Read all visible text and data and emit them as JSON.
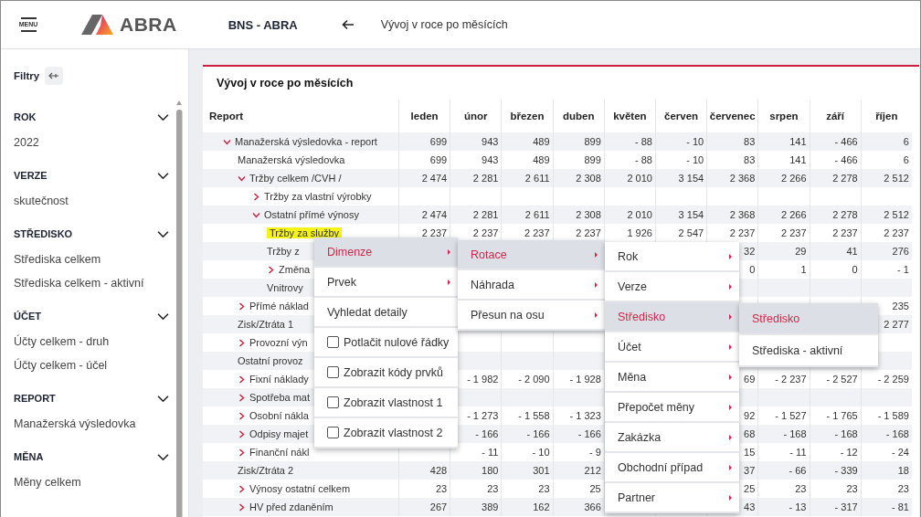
{
  "header": {
    "menu_label": "MENU",
    "logo_text": "ABRA",
    "company": "BNS - ABRA",
    "page_title": "Vývoj v roce po měsících"
  },
  "filters": {
    "title": "Filtry",
    "sections": [
      {
        "title": "ROK",
        "expanded": true,
        "items": [
          "2022"
        ]
      },
      {
        "title": "VERZE",
        "expanded": true,
        "items": [
          "skutečnost"
        ]
      },
      {
        "title": "STŘEDISKO",
        "expanded": true,
        "items": [
          "Střediska celkem",
          "Střediska celkem - aktivní"
        ]
      },
      {
        "title": "ÚČET",
        "expanded": true,
        "items": [
          "Účty celkem - druh",
          "Účty celkem - účel"
        ]
      },
      {
        "title": "REPORT",
        "expanded": true,
        "items": [
          "Manažerská výsledovka"
        ]
      },
      {
        "title": "MĚNA",
        "expanded": true,
        "items": [
          "Měny celkem"
        ]
      }
    ]
  },
  "report": {
    "title": "Vývoj v roce po měsících",
    "columns": [
      "Report",
      "leden",
      "únor",
      "březen",
      "duben",
      "květen",
      "červen",
      "červenec",
      "srpen",
      "září",
      "říjen"
    ],
    "rows": [
      {
        "label": "Manažerská výsledovka - report",
        "kind": "group",
        "expanded": true,
        "highlighted": false,
        "cells": {
          "c1": "699",
          "c2": "943",
          "c3": "489",
          "c4": "899",
          "c5": "- 88",
          "c6": "- 10",
          "c7": "83",
          "c8": "141",
          "c9": "- 466",
          "c10": "6"
        },
        "children": [
          {
            "label": "Manažerská výsledovka",
            "kind": "leaf",
            "highlighted": false,
            "cells": {
              "c1": "699",
              "c2": "943",
              "c3": "489",
              "c4": "899",
              "c5": "- 88",
              "c6": "- 10",
              "c7": "83",
              "c8": "141",
              "c9": "- 466",
              "c10": "6"
            }
          },
          {
            "label": "Tržby celkem /CVH /",
            "kind": "group",
            "expanded": true,
            "highlighted": false,
            "cells": {
              "c1": "2 474",
              "c2": "2 281",
              "c3": "2 611",
              "c4": "2 308",
              "c5": "2 010",
              "c6": "3 154",
              "c7": "2 368",
              "c8": "2 266",
              "c9": "2 278",
              "c10": "2 512"
            },
            "children": [
              {
                "label": "Tržby za vlastní výrobky",
                "kind": "group",
                "expanded": false,
                "highlighted": false
              },
              {
                "label": "Ostatní přímé výnosy",
                "kind": "group",
                "expanded": true,
                "highlighted": false,
                "cells": {
                  "c1": "2 474",
                  "c2": "2 281",
                  "c3": "2 611",
                  "c4": "2 308",
                  "c5": "2 010",
                  "c6": "3 154",
                  "c7": "2 368",
                  "c8": "2 266",
                  "c9": "2 278",
                  "c10": "2 512"
                },
                "children": [
                  {
                    "label": "Tržby za služby",
                    "kind": "leaf",
                    "highlighted": true,
                    "cells": {
                      "c1": "2 237",
                      "c2": "2 237",
                      "c3": "2 237",
                      "c4": "2 237",
                      "c5": "1 926",
                      "c6": "2 547",
                      "c7": "2 237",
                      "c8": "2 237",
                      "c9": "2 237",
                      "c10": "2 237"
                    }
                  },
                  {
                    "label": "Tržby z",
                    "kind": "leaf",
                    "highlighted": false,
                    "cells": {
                      "c7": "32",
                      "c8": "29",
                      "c9": "41",
                      "c10": "276"
                    }
                  },
                  {
                    "label": "Změna",
                    "kind": "group",
                    "expanded": false,
                    "highlighted": false,
                    "cells": {
                      "c7": "0",
                      "c8": "1",
                      "c9": "0",
                      "c10": "- 1"
                    }
                  },
                  {
                    "label": "Vnitrovy",
                    "kind": "leaf",
                    "highlighted": false
                  }
                ]
              }
            ]
          },
          {
            "label": "Přímé náklad",
            "kind": "group",
            "expanded": false,
            "highlighted": false,
            "cells": {
              "c10": "235"
            }
          },
          {
            "label": "Zisk/Ztráta 1",
            "kind": "leaf",
            "highlighted": false,
            "cells": {
              "c10": "2 277"
            }
          },
          {
            "label": "Provozní výn",
            "kind": "group",
            "expanded": false,
            "highlighted": false
          },
          {
            "label": "Ostatní provoz",
            "kind": "leaf",
            "highlighted": false
          },
          {
            "label": "Fixní náklady",
            "kind": "group",
            "expanded": false,
            "highlighted": false,
            "cells": {
              "c2": "- 1 982",
              "c3": "- 2 090",
              "c4": "- 1 928",
              "c7": "69",
              "c8": "- 2 237",
              "c9": "- 2 527",
              "c10": "- 2 259"
            }
          },
          {
            "label": "Spotřeba mat",
            "kind": "group",
            "expanded": false,
            "highlighted": false
          },
          {
            "label": "Osobní nákla",
            "kind": "group",
            "expanded": false,
            "highlighted": false,
            "cells": {
              "c2": "- 1 273",
              "c3": "- 1 558",
              "c4": "- 1 323",
              "c7": "92",
              "c8": "- 1 527",
              "c9": "- 1 765",
              "c10": "- 1 589"
            }
          },
          {
            "label": "Odpisy majet",
            "kind": "group",
            "expanded": false,
            "highlighted": false,
            "cells": {
              "c2": "- 166",
              "c3": "- 166",
              "c4": "- 166",
              "c7": "68",
              "c8": "- 168",
              "c9": "- 168",
              "c10": "- 168"
            }
          },
          {
            "label": "Finanční nákl",
            "kind": "group",
            "expanded": false,
            "highlighted": false,
            "cells": {
              "c2": "- 11",
              "c3": "- 10",
              "c4": "- 9",
              "c7": "15",
              "c8": "- 11",
              "c9": "- 12",
              "c10": "- 24"
            }
          },
          {
            "label": "Zisk/Ztráta 2",
            "kind": "leaf",
            "highlighted": false,
            "cells": {
              "c1": "428",
              "c2": "180",
              "c3": "301",
              "c4": "212",
              "c7": "37",
              "c8": "- 66",
              "c9": "- 339",
              "c10": "18"
            }
          },
          {
            "label": "Výnosy ostatní celkem",
            "kind": "group",
            "expanded": false,
            "highlighted": false,
            "cells": {
              "c1": "23",
              "c2": "23",
              "c3": "23",
              "c4": "25",
              "c7": "25",
              "c8": "23",
              "c9": "23",
              "c10": "23"
            }
          },
          {
            "label": "HV před zdaněním",
            "kind": "group",
            "expanded": false,
            "highlighted": false,
            "cells": {
              "c1": "267",
              "c2": "389",
              "c3": "162",
              "c4": "366",
              "c7": "43",
              "c8": "- 13",
              "c9": "- 317",
              "c10": "- 81"
            }
          }
        ]
      }
    ]
  },
  "context_menus": [
    {
      "items": [
        {
          "label": "Dimenze",
          "kind": "submenu",
          "selected": true
        },
        {
          "label": "Prvek",
          "kind": "submenu",
          "selected": false
        },
        {
          "label": "Vyhledat detaily",
          "kind": "action",
          "selected": false
        },
        {
          "label": "Potlačit nulové řádky",
          "kind": "checkbox",
          "checked": false,
          "selected": false
        },
        {
          "label": "Zobrazit kódy prvků",
          "kind": "checkbox",
          "checked": false,
          "selected": false
        },
        {
          "label": "Zobrazit vlastnost 1",
          "kind": "checkbox",
          "checked": false,
          "selected": false
        },
        {
          "label": "Zobrazit vlastnost 2",
          "kind": "checkbox",
          "checked": false,
          "selected": false
        }
      ]
    },
    {
      "items": [
        {
          "label": "Rotace",
          "kind": "submenu",
          "selected": true
        },
        {
          "label": "Náhrada",
          "kind": "submenu",
          "selected": false
        },
        {
          "label": "Přesun na osu",
          "kind": "submenu",
          "selected": false
        }
      ]
    },
    {
      "items": [
        {
          "label": "Rok",
          "kind": "submenu",
          "selected": false
        },
        {
          "label": "Verze",
          "kind": "submenu",
          "selected": false
        },
        {
          "label": "Středisko",
          "kind": "submenu",
          "selected": true
        },
        {
          "label": "Účet",
          "kind": "submenu",
          "selected": false
        },
        {
          "label": "Měna",
          "kind": "submenu",
          "selected": false
        },
        {
          "label": "Přepočet měny",
          "kind": "submenu",
          "selected": false
        },
        {
          "label": "Zakázka",
          "kind": "submenu",
          "selected": false
        },
        {
          "label": "Obchodní případ",
          "kind": "submenu",
          "selected": false
        },
        {
          "label": "Partner",
          "kind": "submenu",
          "selected": false
        }
      ]
    },
    {
      "items": [
        {
          "label": "Středisko",
          "kind": "action",
          "selected": true
        },
        {
          "label": "Střediska - aktivní",
          "kind": "action",
          "selected": false
        }
      ]
    }
  ]
}
